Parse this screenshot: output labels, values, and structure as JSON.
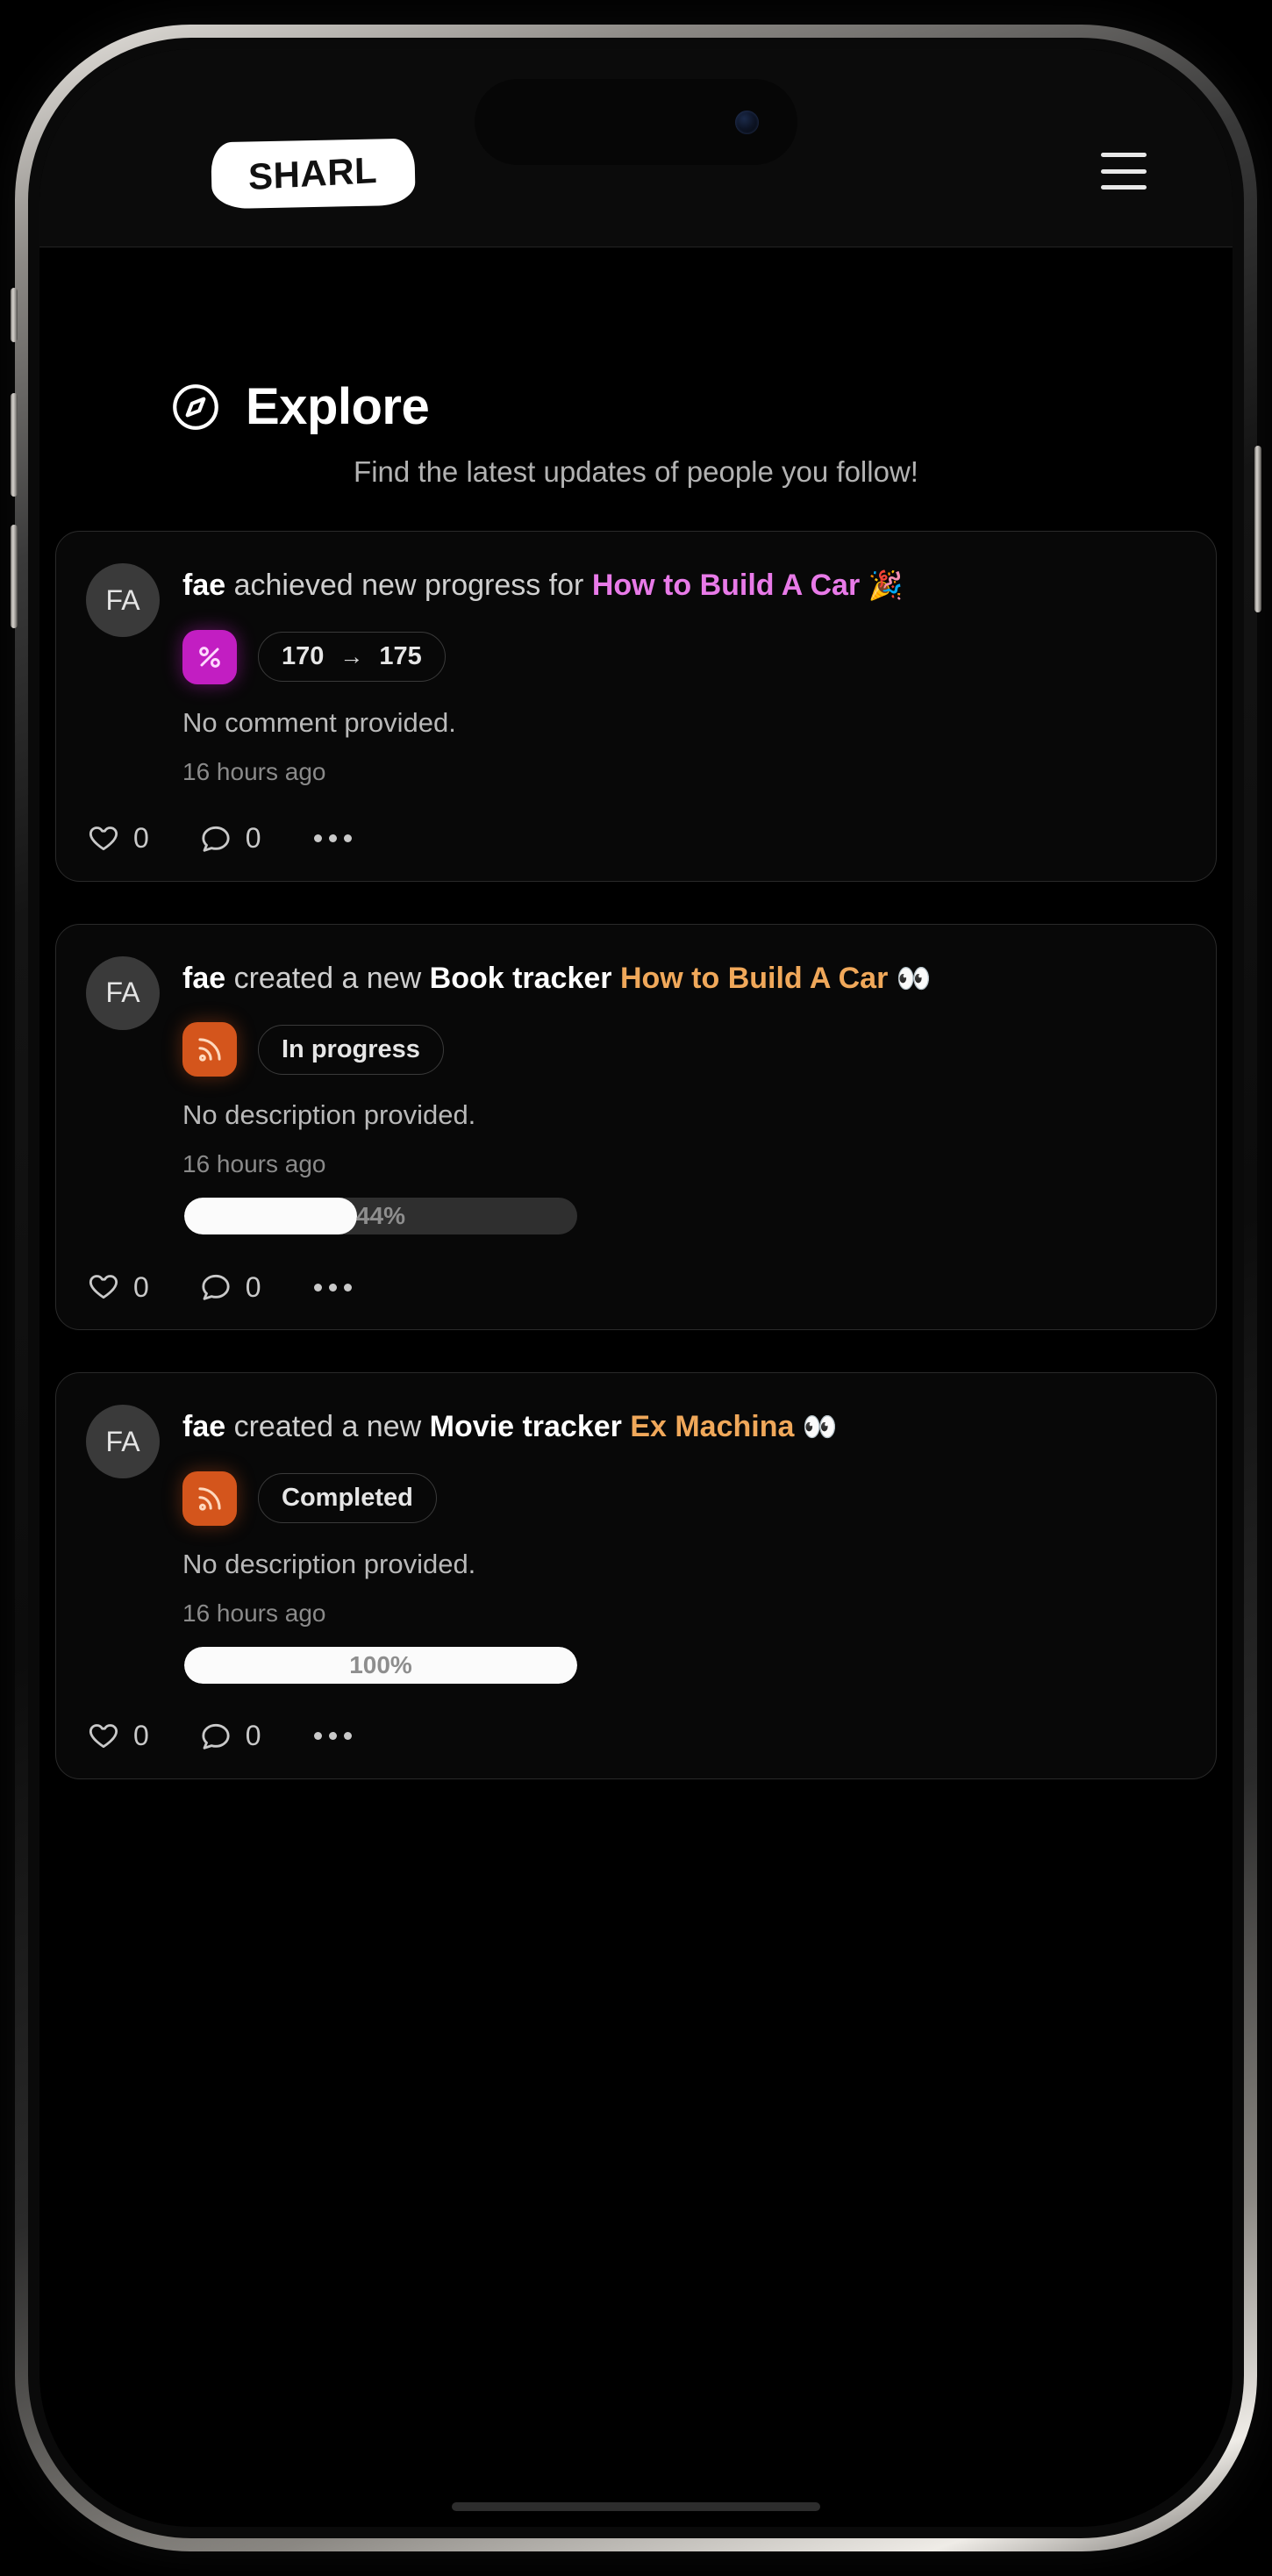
{
  "app": {
    "logo_text": "SHARL",
    "menu_icon": "hamburger-menu-icon",
    "camera_icon": "front-camera-icon"
  },
  "page": {
    "icon": "compass-icon",
    "title": "Explore",
    "subtitle": "Find the latest updates of people you follow!"
  },
  "colors": {
    "accent_pink": "#e87ae8",
    "accent_amber": "#f0a85a",
    "badge_percent": "#c21ec2",
    "badge_rss": "#d4551c",
    "card_bg": "#080808",
    "card_border": "#2a2a2a"
  },
  "feed": [
    {
      "avatar_initials": "FA",
      "user": "fae",
      "action_text": "achieved new progress for",
      "kind": "",
      "target": "How to Build A Car",
      "target_color": "pink",
      "emoji": "🎉",
      "badge_icon": "percent-icon",
      "badge_type": "percent",
      "pill_type": "progress-range",
      "pill_from": "170",
      "pill_arrow": "→",
      "pill_to": "175",
      "description": "No comment provided.",
      "time": "16 hours ago",
      "progress": null,
      "likes": "0",
      "comments": "0",
      "more_icon": "ellipsis-icon"
    },
    {
      "avatar_initials": "FA",
      "user": "fae",
      "action_text": "created a new",
      "kind": "Book tracker",
      "target": "How to Build A Car",
      "target_color": "amber",
      "emoji": "👀",
      "badge_icon": "rss-icon",
      "badge_type": "rss",
      "pill_type": "status",
      "status": "In progress",
      "description": "No description provided.",
      "time": "16 hours ago",
      "progress": {
        "percent": 44,
        "label": "44%"
      },
      "likes": "0",
      "comments": "0",
      "more_icon": "ellipsis-icon"
    },
    {
      "avatar_initials": "FA",
      "user": "fae",
      "action_text": "created a new",
      "kind": "Movie tracker",
      "target": "Ex Machina",
      "target_color": "amber",
      "emoji": "👀",
      "badge_icon": "rss-icon",
      "badge_type": "rss",
      "pill_type": "status",
      "status": "Completed",
      "description": "No description provided.",
      "time": "16 hours ago",
      "progress": {
        "percent": 100,
        "label": "100%"
      },
      "likes": "0",
      "comments": "0",
      "more_icon": "ellipsis-icon"
    }
  ]
}
